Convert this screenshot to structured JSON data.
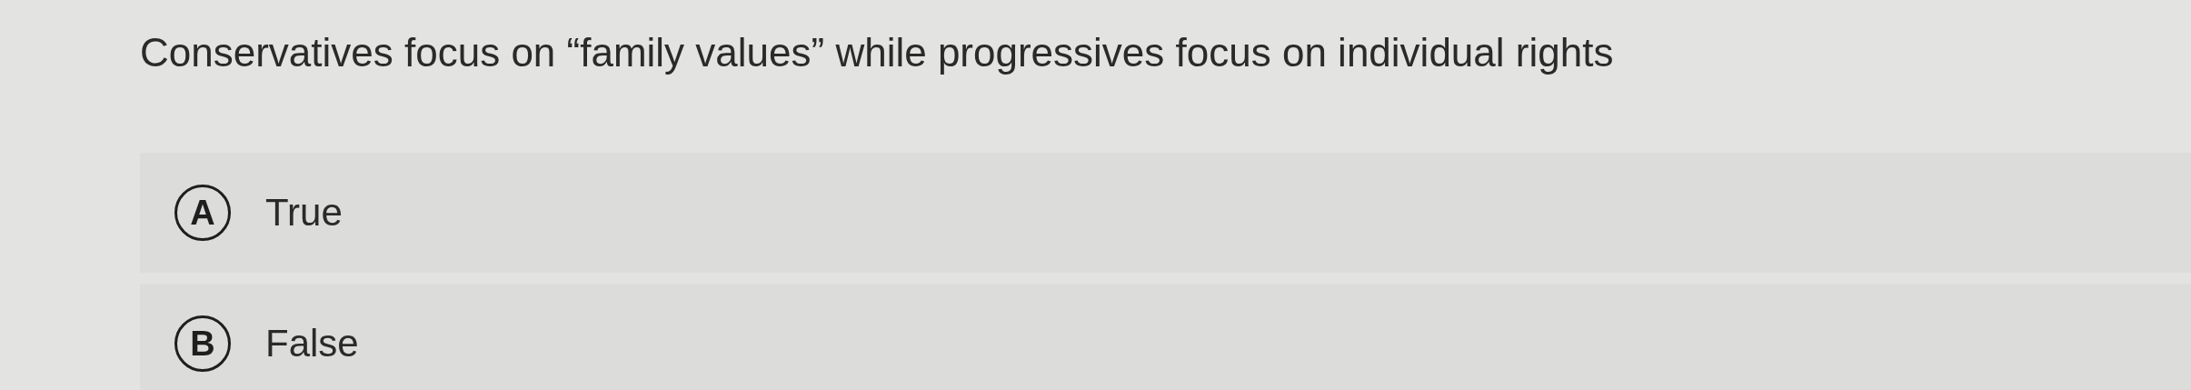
{
  "question": "Conservatives focus on “family values” while progressives focus on individual rights",
  "options": [
    {
      "letter": "A",
      "label": "True",
      "selected": false
    },
    {
      "letter": "B",
      "label": "False",
      "selected": false
    }
  ]
}
